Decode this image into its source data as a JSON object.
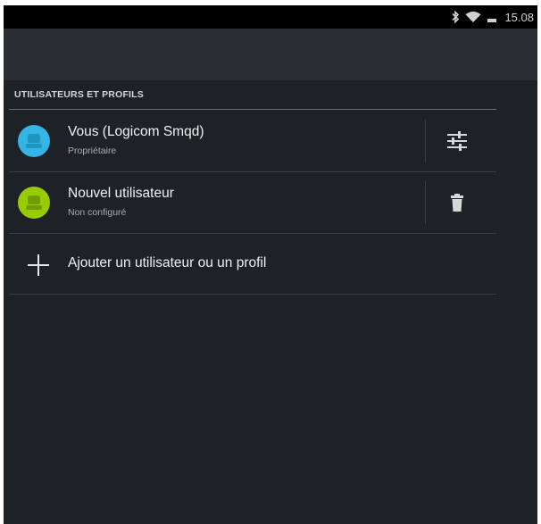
{
  "statusbar": {
    "time": "15.08",
    "icons": [
      "bluetooth-icon",
      "wifi-icon",
      "battery-icon"
    ]
  },
  "section": {
    "header": "UTILISATEURS ET PROFILS"
  },
  "users": [
    {
      "name": "Vous (Logicom Smqd)",
      "role": "Propriétaire",
      "avatar_color": "#35b5e5",
      "action_icon": "settings-sliders-icon"
    },
    {
      "name": "Nouvel utilisateur",
      "role": "Non configuré",
      "avatar_color": "#99cc00",
      "action_icon": "trash-icon"
    }
  ],
  "add_user": {
    "label": "Ajouter un utilisateur ou un profil",
    "icon": "plus-icon"
  },
  "colors": {
    "background": "#1e2227",
    "text_primary": "#f0f0f0",
    "text_secondary": "#a9adb2"
  }
}
